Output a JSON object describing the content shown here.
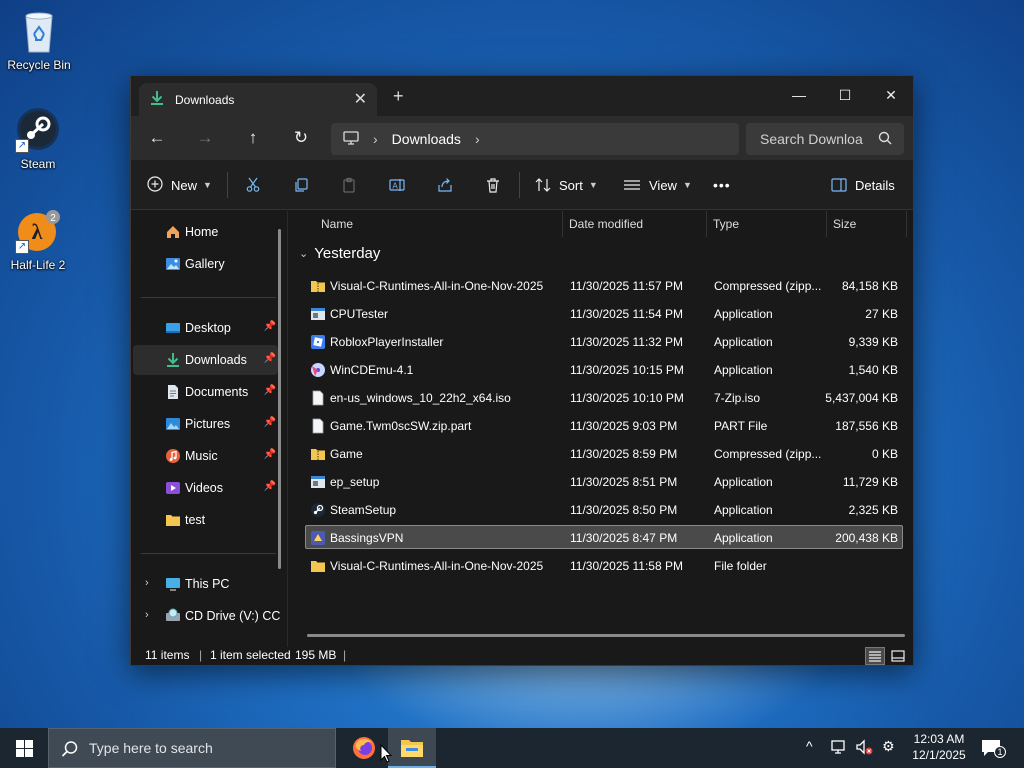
{
  "desktop": {
    "icons": [
      {
        "label": "Recycle Bin",
        "icon": "recycle-bin-icon"
      },
      {
        "label": "Steam",
        "icon": "steam-icon"
      },
      {
        "label": "Half-Life 2",
        "icon": "half-life-2-icon"
      }
    ]
  },
  "window": {
    "tab": {
      "title": "Downloads",
      "icon": "download-arrow-icon"
    },
    "controls": [
      "minimize",
      "maximize",
      "close"
    ],
    "nav": {
      "breadcrumb": [
        "Downloads"
      ],
      "search_placeholder": "Search Downloa"
    },
    "commandbar": {
      "new_label": "New",
      "sort_label": "Sort",
      "view_label": "View",
      "more_label": "•••",
      "details_label": "Details"
    },
    "sidebar": {
      "top": [
        {
          "label": "Home",
          "icon": "home-icon"
        },
        {
          "label": "Gallery",
          "icon": "gallery-icon"
        }
      ],
      "quick": [
        {
          "label": "Desktop",
          "icon": "desktop-icon",
          "pinned": true
        },
        {
          "label": "Downloads",
          "icon": "download-icon",
          "pinned": true,
          "active": true
        },
        {
          "label": "Documents",
          "icon": "documents-icon",
          "pinned": true
        },
        {
          "label": "Pictures",
          "icon": "pictures-icon",
          "pinned": true
        },
        {
          "label": "Music",
          "icon": "music-icon",
          "pinned": true
        },
        {
          "label": "Videos",
          "icon": "videos-icon",
          "pinned": true
        },
        {
          "label": "test",
          "icon": "folder-icon",
          "pinned": false
        }
      ],
      "drives": [
        {
          "label": "This PC",
          "icon": "this-pc-icon"
        },
        {
          "label": "CD Drive (V:) CC",
          "icon": "cd-drive-icon"
        }
      ]
    },
    "columns": {
      "name": "Name",
      "date": "Date modified",
      "type": "Type",
      "size": "Size"
    },
    "group": "Yesterday",
    "files": [
      {
        "name": "Visual-C-Runtimes-All-in-One-Nov-2025",
        "date": "11/30/2025 11:57 PM",
        "type": "Compressed (zipp...",
        "size": "84,158 KB",
        "icon": "zip-folder-icon"
      },
      {
        "name": "CPUTester",
        "date": "11/30/2025 11:54 PM",
        "type": "Application",
        "size": "27 KB",
        "icon": "app-icon"
      },
      {
        "name": "RobloxPlayerInstaller",
        "date": "11/30/2025 11:32 PM",
        "type": "Application",
        "size": "9,339 KB",
        "icon": "roblox-icon"
      },
      {
        "name": "WinCDEmu-4.1",
        "date": "11/30/2025 10:15 PM",
        "type": "Application",
        "size": "1,540 KB",
        "icon": "wincdemu-icon"
      },
      {
        "name": "en-us_windows_10_22h2_x64.iso",
        "date": "11/30/2025 10:10 PM",
        "type": "7-Zip.iso",
        "size": "5,437,004 KB",
        "icon": "file-icon"
      },
      {
        "name": "Game.Twm0scSW.zip.part",
        "date": "11/30/2025 9:03 PM",
        "type": "PART File",
        "size": "187,556 KB",
        "icon": "file-icon"
      },
      {
        "name": "Game",
        "date": "11/30/2025 8:59 PM",
        "type": "Compressed (zipp...",
        "size": "0 KB",
        "icon": "zip-folder-icon"
      },
      {
        "name": "ep_setup",
        "date": "11/30/2025 8:51 PM",
        "type": "Application",
        "size": "11,729 KB",
        "icon": "app-icon"
      },
      {
        "name": "SteamSetup",
        "date": "11/30/2025 8:50 PM",
        "type": "Application",
        "size": "2,325 KB",
        "icon": "steam-setup-icon"
      },
      {
        "name": "BassingsVPN",
        "date": "11/30/2025 8:47 PM",
        "type": "Application",
        "size": "200,438 KB",
        "icon": "vpn-app-icon",
        "selected": true
      },
      {
        "name": "Visual-C-Runtimes-All-in-One-Nov-2025",
        "date": "11/30/2025 11:58 PM",
        "type": "File folder",
        "size": "",
        "icon": "folder-icon"
      }
    ],
    "status": {
      "items": "11 items",
      "selected": "1 item selected",
      "size": "195 MB"
    }
  },
  "taskbar": {
    "search_placeholder": "Type here to search",
    "apps": [
      "firefox-icon",
      "file-explorer-icon"
    ],
    "time": "12:03 AM",
    "date": "12/1/2025",
    "notification_count": "1"
  },
  "colors": {
    "window_bg": "#191919",
    "selected_row": "#4a4a4a",
    "accent": "#4cc2ff",
    "folder": "#f3c74f",
    "taskbar": "#1c2630"
  }
}
